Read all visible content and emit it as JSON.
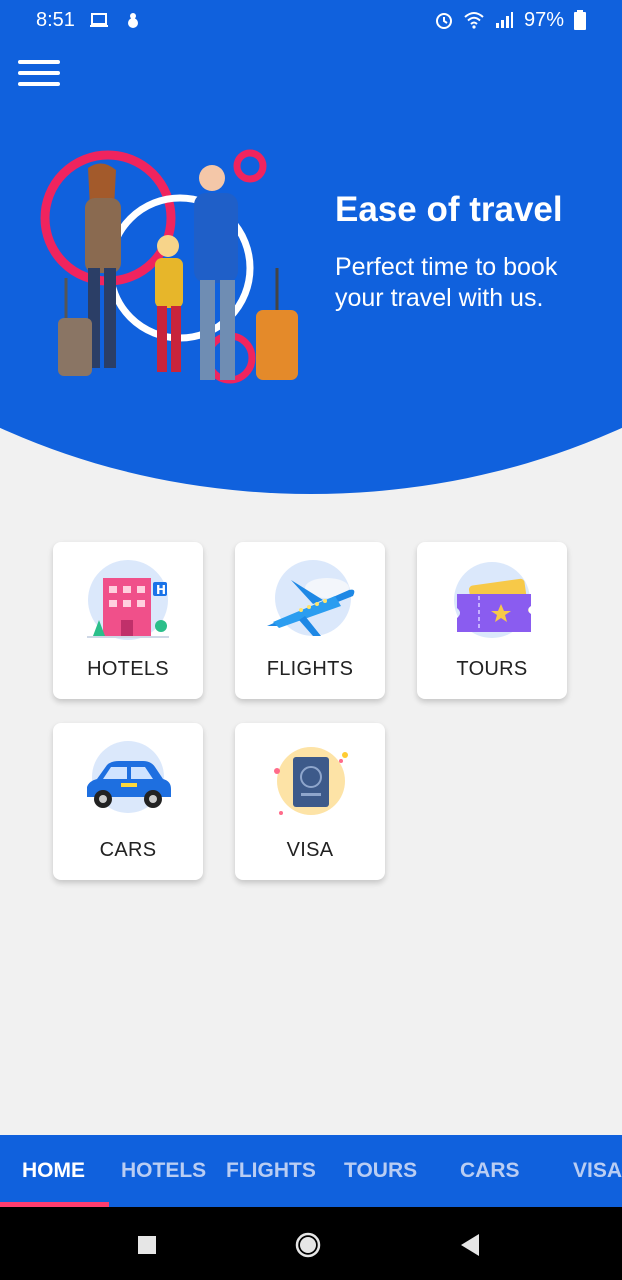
{
  "status": {
    "time": "8:51",
    "battery": "97%",
    "icons": [
      "laptop-icon",
      "bug-icon",
      "alarm-icon",
      "wifi-icon",
      "signal-icon",
      "battery-icon"
    ]
  },
  "hero": {
    "title": "Ease of travel",
    "subtitle": "Perfect time to book your travel with us.",
    "slides": 3,
    "active_slide": 1
  },
  "categories": [
    {
      "label": "HOTELS",
      "icon": "hotel-icon"
    },
    {
      "label": "FLIGHTS",
      "icon": "airplane-icon"
    },
    {
      "label": "TOURS",
      "icon": "ticket-icon"
    },
    {
      "label": "CARS",
      "icon": "car-icon"
    },
    {
      "label": "VISA",
      "icon": "passport-icon"
    }
  ],
  "tabs": [
    {
      "label": "HOME",
      "active": true
    },
    {
      "label": "HOTELS"
    },
    {
      "label": "FLIGHTS"
    },
    {
      "label": "TOURS"
    },
    {
      "label": "CARS"
    },
    {
      "label": "VISA"
    }
  ],
  "colors": {
    "primary": "#1061dd",
    "accent": "#ff3d6e",
    "background": "#f1f1f1"
  }
}
